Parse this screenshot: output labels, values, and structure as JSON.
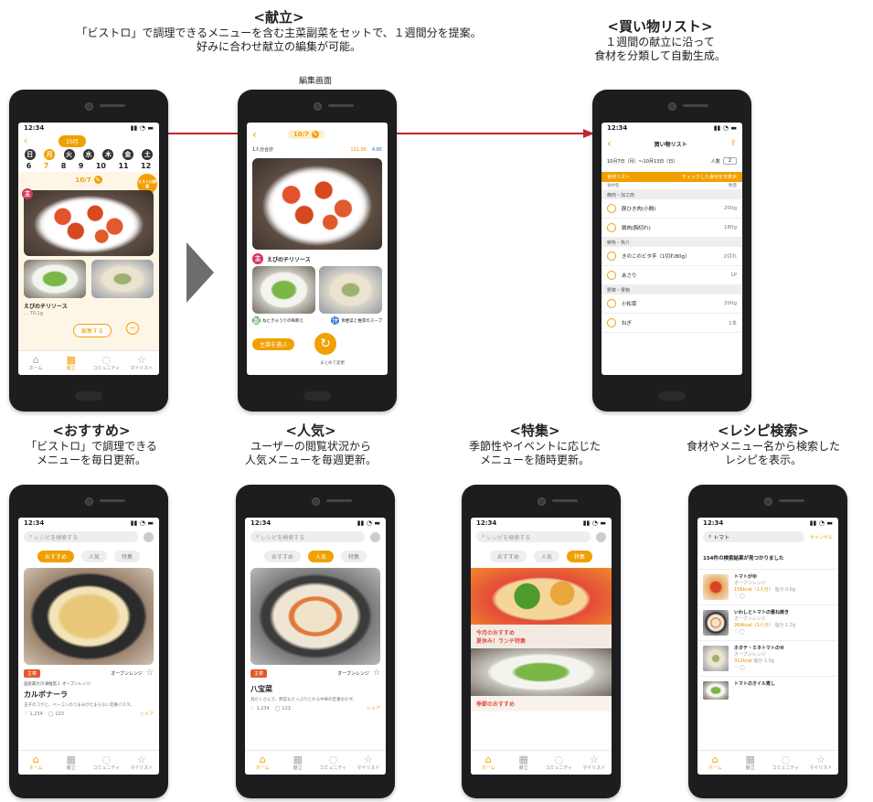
{
  "headings": {
    "menu": {
      "title": "<献立>",
      "desc1": "「ビストロ」で調理できるメニューを含む主菜副菜をセットで、１週間分を提案。",
      "desc2": "好みに合わせ献立の編集が可能。"
    },
    "edit_label": "編集画面",
    "shopping": {
      "title": "<買い物リスト>",
      "desc1": "１週間の献立に沿って",
      "desc2": "食材を分類して自動生成。"
    },
    "recommend": {
      "title": "<おすすめ>",
      "desc1": "「ビストロ」で調理できる",
      "desc2": "メニューを毎日更新。"
    },
    "popular": {
      "title": "<人気>",
      "desc1": "ユーザーの閲覧状況から",
      "desc2": "人気メニューを毎週更新。"
    },
    "feature": {
      "title": "<特集>",
      "desc1": "季節性やイベントに応じた",
      "desc2": "メニューを随時更新。"
    },
    "search": {
      "title": "<レシピ検索>",
      "desc1": "食材やメニュー名から検索した",
      "desc2": "レシピを表示。"
    }
  },
  "status_time": "12:34",
  "nav": [
    "ホーム",
    "献立",
    "コミュニティ",
    "マイリスト"
  ],
  "menu_screen": {
    "month": "10月",
    "days": [
      "6",
      "7",
      "8",
      "9",
      "10",
      "11",
      "12"
    ],
    "dows": [
      "日",
      "月",
      "火",
      "水",
      "木",
      "金",
      "土"
    ],
    "date_label": "10/7",
    "dish": "えびのチリソース",
    "dish_sub": "… 70.1g",
    "edit_btn": "編集する",
    "bubble": "ビストロ調理"
  },
  "edit_screen": {
    "date_label": "10/7",
    "summary": "1人分合計",
    "kcal": "131.00",
    "salt": "4.85",
    "main_dish": "えびのチリソース",
    "side1": "ねときゅうりの梅和え",
    "side2": "青梗菜と椎茸のスープ",
    "btn": "主菜を選ぶ",
    "shuffle": "まとめて変更"
  },
  "shopping_screen": {
    "title": "買い物リスト",
    "range": "10月7日（月）〜10月13日（日）",
    "people_label": "人数",
    "people_val": "2",
    "tab_left": "食材リスト",
    "tab_right": "チェックした食材を非表示",
    "col_left": "食材名",
    "col_right": "数量",
    "groups": [
      {
        "cat": "精肉・加工肉",
        "items": [
          {
            "name": "豚ひき肉(小間)",
            "qty": "200g"
          },
          {
            "name": "鶏肉(胸切れ)",
            "qty": "180g"
          }
        ]
      },
      {
        "cat": "鮮魚・魚介",
        "items": [
          {
            "name": "きのこのビタ芋（1切れ80g）",
            "qty": "2切れ"
          },
          {
            "name": "あさり",
            "qty": "1P"
          }
        ]
      },
      {
        "cat": "野菜・果物",
        "items": [
          {
            "name": "小松菜",
            "qty": "200g"
          },
          {
            "name": "ねぎ",
            "qty": "1本"
          }
        ]
      }
    ]
  },
  "recommend_screen": {
    "search_ph": "レシピを検索する",
    "tabs": [
      "おすすめ",
      "人気",
      "特集"
    ],
    "badge": "主菜",
    "maker": "オーブンレンジ",
    "sub": "国産最大冷凍推奨１ オーブンレンジ",
    "dish": "カルボナーラ",
    "desc": "玉子のコクと、ベーコンのうまみがたまらない定番パスタ。",
    "likes": "1,234",
    "comments": "123",
    "share": "シェア"
  },
  "popular_screen": {
    "search_ph": "レシピを検索する",
    "tabs": [
      "おすすめ",
      "人気",
      "特集"
    ],
    "badge": "主菜",
    "maker": "オーブンレンジ",
    "dish": "八宝菜",
    "desc": "具だくさんで、野菜もたっぷりとれる中華の定番おかず。",
    "likes": "1,234",
    "comments": "123",
    "share": "シェア"
  },
  "feature_screen": {
    "search_ph": "レシピを検索する",
    "tabs": [
      "おすすめ",
      "人気",
      "特集"
    ],
    "banner1_line1": "今月のおすすめ",
    "banner1_line2": "夏休み！ランチ特集",
    "banner2": "季節のおすすめ"
  },
  "search_screen": {
    "query": "トマト",
    "cancel": "キャンセル",
    "count": "154件の検索結果が見つかりました",
    "results": [
      {
        "name": "トマトがゆ",
        "maker": "オーブンレンジ",
        "kcal": "156kcal（1人分）",
        "salt": "塩分 0.6g"
      },
      {
        "name": "いわしとトマトの重ね焼き",
        "maker": "オーブンレンジ",
        "kcal": "264kcal（1人分）",
        "salt": "塩分 1.2g"
      },
      {
        "name": "ホタテ・ミネトマトのせ",
        "maker": "オーブンレンジ",
        "kcal": "312kcal",
        "salt": "塩分 1.0g"
      },
      {
        "name": "トマトのオイル煮し",
        "maker": "",
        "kcal": "",
        "salt": ""
      }
    ]
  }
}
